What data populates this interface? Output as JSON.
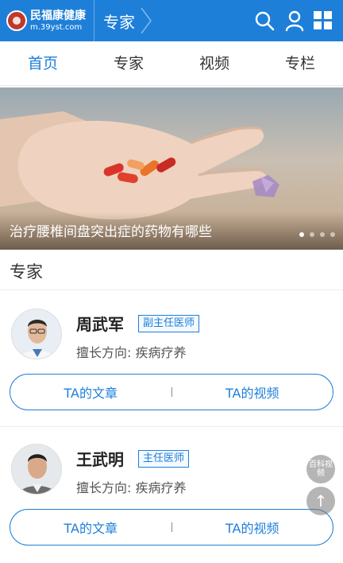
{
  "header": {
    "logo_cn": "民福康健康",
    "logo_url": "m.39yst.com",
    "title": "专家",
    "icons": [
      "search-icon",
      "user-icon",
      "grid-menu-icon"
    ],
    "accent": "#1e7fd9"
  },
  "tabs": [
    {
      "label": "首页",
      "active": true
    },
    {
      "label": "专家",
      "active": false
    },
    {
      "label": "视频",
      "active": false
    },
    {
      "label": "专栏",
      "active": false
    }
  ],
  "banner": {
    "caption": "治疗腰椎间盘突出症的药物有哪些",
    "dots": 4,
    "active_dot": 1
  },
  "section": {
    "title": "专家"
  },
  "experts": [
    {
      "name": "周武军",
      "title": "副主任医师",
      "specialty": "擅长方向: 疾病疗养",
      "articles_label": "TA的文章",
      "videos_label": "TA的视频"
    },
    {
      "name": "王武明",
      "title": "主任医师",
      "specialty": "擅长方向: 疾病疗养",
      "articles_label": "TA的文章",
      "videos_label": "TA的视频"
    }
  ],
  "floating": {
    "share_label": "百科视频",
    "top_label": "↑"
  }
}
